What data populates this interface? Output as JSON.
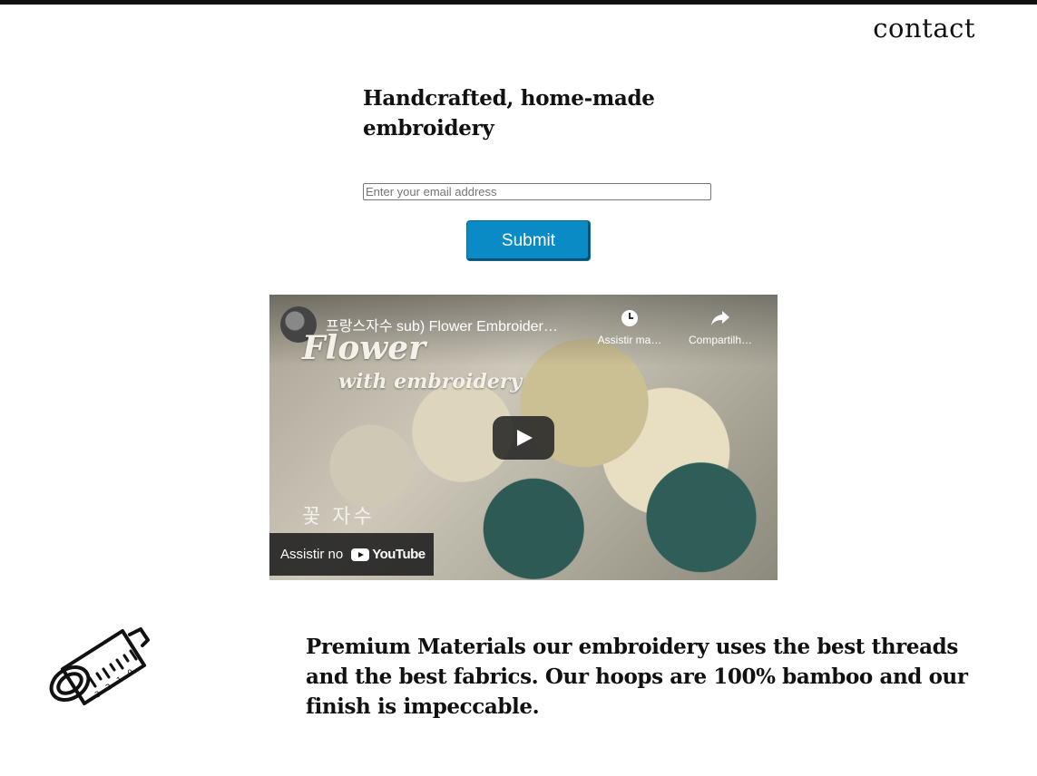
{
  "nav": {
    "contact_label": "contact"
  },
  "hero": {
    "title": "Handcrafted, home-made embroidery"
  },
  "signup": {
    "email_placeholder": "Enter your email address",
    "submit_label": "Submit",
    "submit_color": "#0b8bc6"
  },
  "video": {
    "title": "프랑스자수 sub) Flower Embroider…",
    "watch_later_label": "Assistir ma…",
    "share_label": "Compartilh…",
    "thumbnail_text_line1": "Flower",
    "thumbnail_text_line2": "with embroidery",
    "thumbnail_text_korean": "꽃 자수",
    "watch_on_label": "Assistir no",
    "platform_name": "YouTube"
  },
  "feature": {
    "icon": "sewing-ruler-icon",
    "text": "Premium Materials our embroidery uses the best threads and the best fabrics. Our hoops are 100% bamboo and our finish is impeccable."
  }
}
